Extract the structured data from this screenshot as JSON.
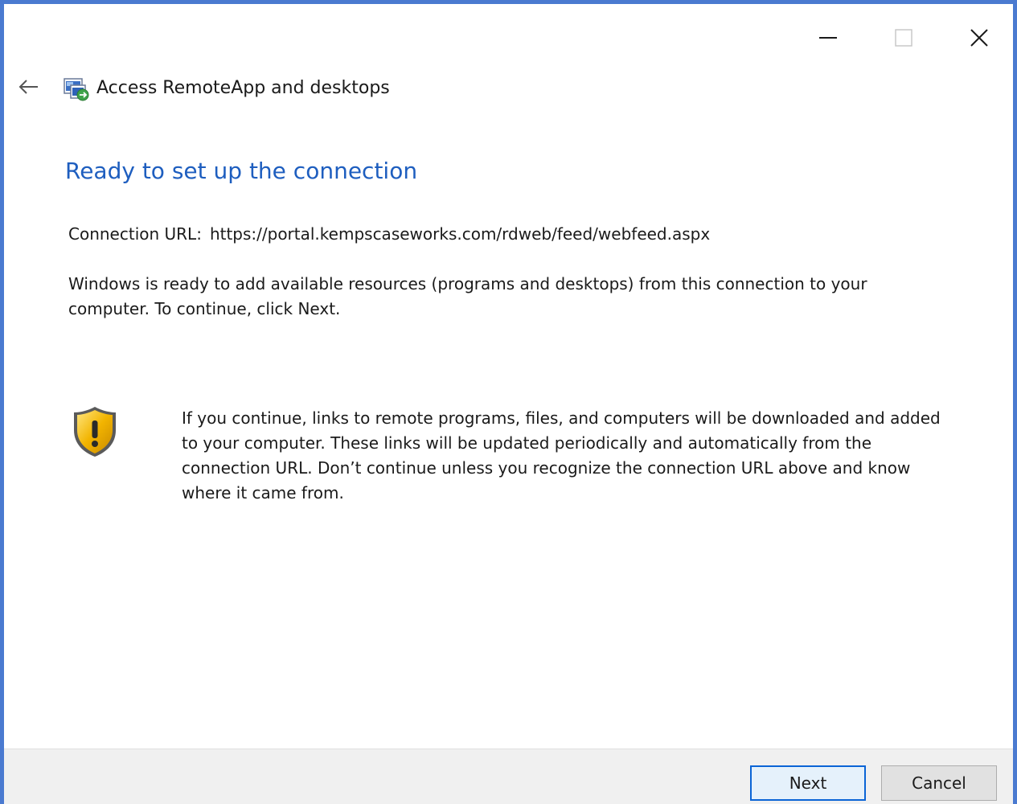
{
  "window": {
    "caption_buttons": {
      "minimize_icon": "minimize-icon",
      "maximize_icon": "maximize-icon",
      "close_icon": "close-icon"
    },
    "accent_color": "#4a7ad0"
  },
  "nav": {
    "back_icon": "back-arrow-icon",
    "app_icon": "remoteapp-icon",
    "title": "Access RemoteApp and desktops"
  },
  "content": {
    "heading": "Ready to set up the connection",
    "heading_color": "#1e5ebf",
    "url_label": "Connection URL:",
    "url_value": "https://portal.kempscaseworks.com/rdweb/feed/webfeed.aspx",
    "description": "Windows is ready to add available resources (programs and desktops) from this connection to your computer. To continue, click Next.",
    "warning_icon": "shield-warning-icon",
    "warning_text": "If you continue, links to remote programs, files, and computers will be downloaded and added to your computer.  These links will be updated periodically and automatically from the connection URL. Don’t continue unless you recognize the connection URL above and know where it came from."
  },
  "footer": {
    "next_label": "Next",
    "cancel_label": "Cancel"
  }
}
